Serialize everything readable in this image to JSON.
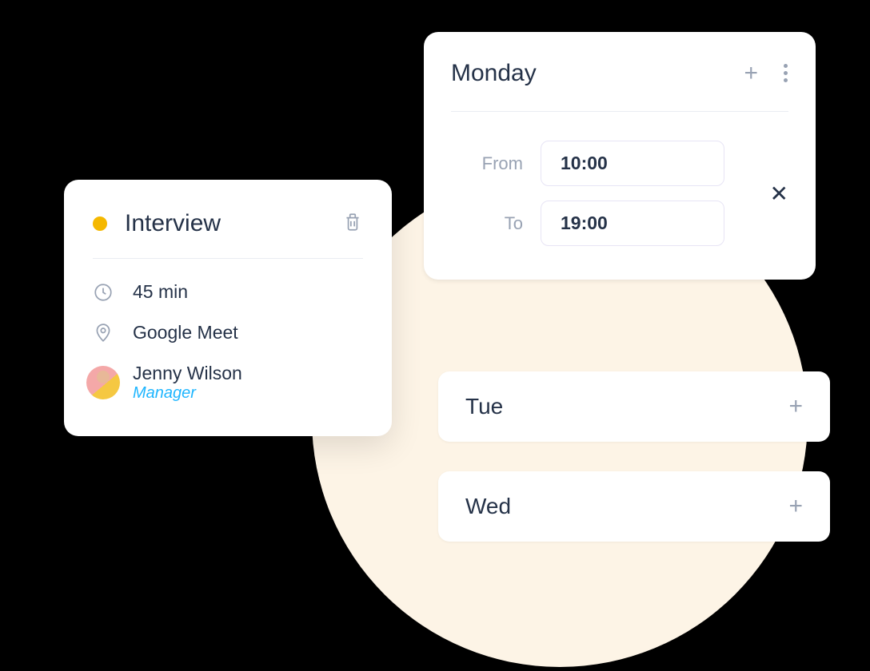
{
  "interview": {
    "title": "Interview",
    "duration": "45 min",
    "location": "Google Meet",
    "person": {
      "name": "Jenny Wilson",
      "role": "Manager"
    }
  },
  "schedule": {
    "monday": {
      "title": "Monday",
      "from_label": "From",
      "to_label": "To",
      "from_value": "10:00",
      "to_value": "19:00"
    },
    "tuesday": {
      "label": "Tue"
    },
    "wednesday": {
      "label": "Wed"
    }
  }
}
